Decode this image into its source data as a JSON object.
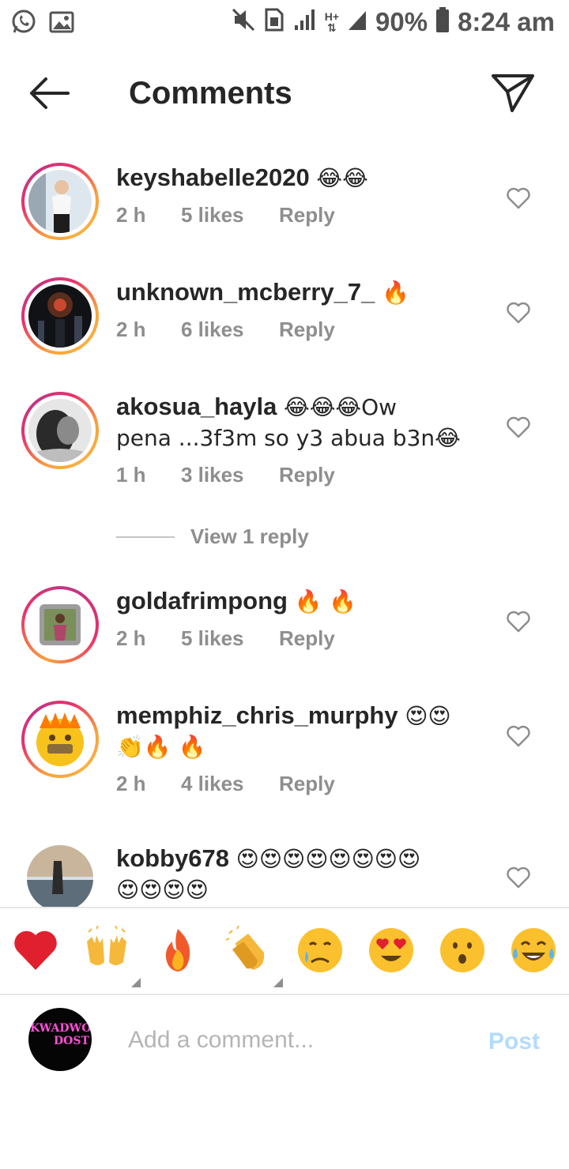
{
  "status_bar": {
    "battery": "90%",
    "time": "8:24 am",
    "network": "H+"
  },
  "header": {
    "title": "Comments"
  },
  "comments": [
    {
      "username": "keyshabelle2020",
      "text": "😂😂",
      "text2": "",
      "time": "2 h",
      "likes": "5 likes",
      "reply": "Reply"
    },
    {
      "username": "unknown_mcberry_7_",
      "text": "🔥",
      "text2": "",
      "time": "2 h",
      "likes": "6 likes",
      "reply": "Reply"
    },
    {
      "username": "akosua_hayla",
      "text": "😂😂😂Ow",
      "text2": "pena ...3f3m so y3 abua b3n😂",
      "time": "1 h",
      "likes": "3 likes",
      "reply": "Reply"
    },
    {
      "username": "goldafrimpong",
      "text": "🔥 🔥",
      "text2": "",
      "time": "2 h",
      "likes": "5 likes",
      "reply": "Reply"
    },
    {
      "username": "memphiz_chris_murphy",
      "text": "😍😍",
      "text2": "👏🔥 🔥",
      "time": "2 h",
      "likes": "4 likes",
      "reply": "Reply"
    },
    {
      "username": "kobby678",
      "text": "😍😍😍😍😍😍😍😍",
      "text2": "😍😍😍😍",
      "time": "",
      "likes": "",
      "reply": ""
    }
  ],
  "view_replies": "View 1 reply",
  "my_avatar": {
    "line1": "KWADWO",
    "line2": "DOST"
  },
  "composer": {
    "placeholder": "Add a comment...",
    "post_label": "Post"
  },
  "colors": {
    "text": "#262626",
    "meta": "#8e8e8e",
    "post_disabled": "#b3dbff",
    "ring_orange": "#f9a23b",
    "ring_pink": "#e8316b"
  }
}
